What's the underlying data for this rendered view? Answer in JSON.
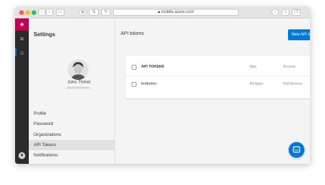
{
  "browser": {
    "url": "mobile.azure.com",
    "colors": {
      "close": "#ff5f57",
      "minimize": "#ffbd2e",
      "maximize": "#28c940"
    }
  },
  "rail": {
    "logo_icon": "devops-logo-icon",
    "menu_icon": "hamburger-icon",
    "home_icon": "home-icon",
    "user_icon": "user-icon"
  },
  "settings": {
    "title": "Settings",
    "user": {
      "name": "John Thiriet"
    },
    "nav": [
      {
        "label": "Profile",
        "active": false
      },
      {
        "label": "Password",
        "active": false
      },
      {
        "label": "Organizations",
        "active": false
      },
      {
        "label": "API Tokens",
        "active": true
      },
      {
        "label": "Notifications",
        "active": false
      }
    ]
  },
  "main": {
    "title": "API tokens",
    "new_button": "New API token",
    "table": {
      "headers": [
        "API TOKENS",
        "App",
        "Access"
      ],
      "rows": [
        {
          "name": "testtoken",
          "app": "All Apps",
          "access": "Full Access"
        }
      ]
    }
  },
  "colors": {
    "accent": "#0078d4",
    "brand": "#c30052",
    "rail": "#2b2b2b"
  }
}
